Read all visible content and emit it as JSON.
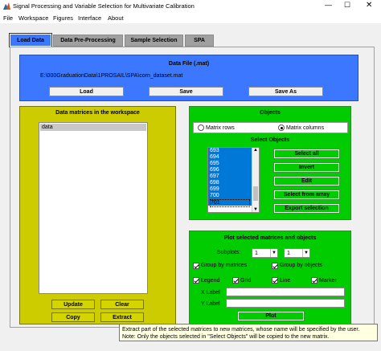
{
  "window": {
    "title": "Signal Processing and Variable Selection for Multivariate Calibration"
  },
  "menu": [
    "File",
    "Workspace",
    "Figures",
    "Interface",
    "About"
  ],
  "tabs": [
    {
      "label": "Load Data",
      "active": true
    },
    {
      "label": "Data Pre-Processing",
      "active": false
    },
    {
      "label": "Sample Selection",
      "active": false
    },
    {
      "label": "SPA",
      "active": false
    }
  ],
  "data_file": {
    "title": "Data File (.mat)",
    "path": "E:\\000GraduationData\\1PROSAIL\\SPA\\corn_dataset.mat",
    "load_label": "Load",
    "save_label": "Save",
    "save_as_label": "Save As"
  },
  "workspace": {
    "title": "Data matrices in the workspace",
    "items": [
      "data"
    ],
    "update_label": "Update",
    "clear_label": "Clear",
    "copy_label": "Copy",
    "extract_label": "Extract"
  },
  "objects": {
    "title": "Objects",
    "radio_rows": "Matrix rows",
    "radio_cols": "Matrix columns",
    "select_title": "Select Objects",
    "list": [
      "693",
      "694",
      "695",
      "696",
      "697",
      "698",
      "699",
      "700",
      "701"
    ],
    "select_all_label": "Select all",
    "invert_label": "Invert",
    "edit_label": "Edit",
    "select_from_array_label": "Select from array",
    "export_selection_label": "Export selection"
  },
  "plot": {
    "title": "Plot selected matrices and objects",
    "subplots_label": "Subplots:",
    "subplot_rows": "1",
    "subplot_cols": "1",
    "group_by_matrices": "Group by matrices",
    "group_by_objects": "Group by objects",
    "legend": "Legend",
    "grid": "Grid",
    "line": "Line",
    "marker": "Marker",
    "xlabel": "X Label",
    "ylabel": "Y Label",
    "plot_label": "Plot"
  },
  "tooltip": {
    "line1": "Extract part of the selected matrices to new matrices, whose name will be specified by the user.",
    "line2": "Note: Only the objects selected in \"Select Objects\" will be copied to the new matrix."
  },
  "colors": {
    "blue_panel": "#3c78ff",
    "green_panel": "#00cc00",
    "olive_panel": "#cccc00",
    "list_selection": "#0078d7"
  }
}
